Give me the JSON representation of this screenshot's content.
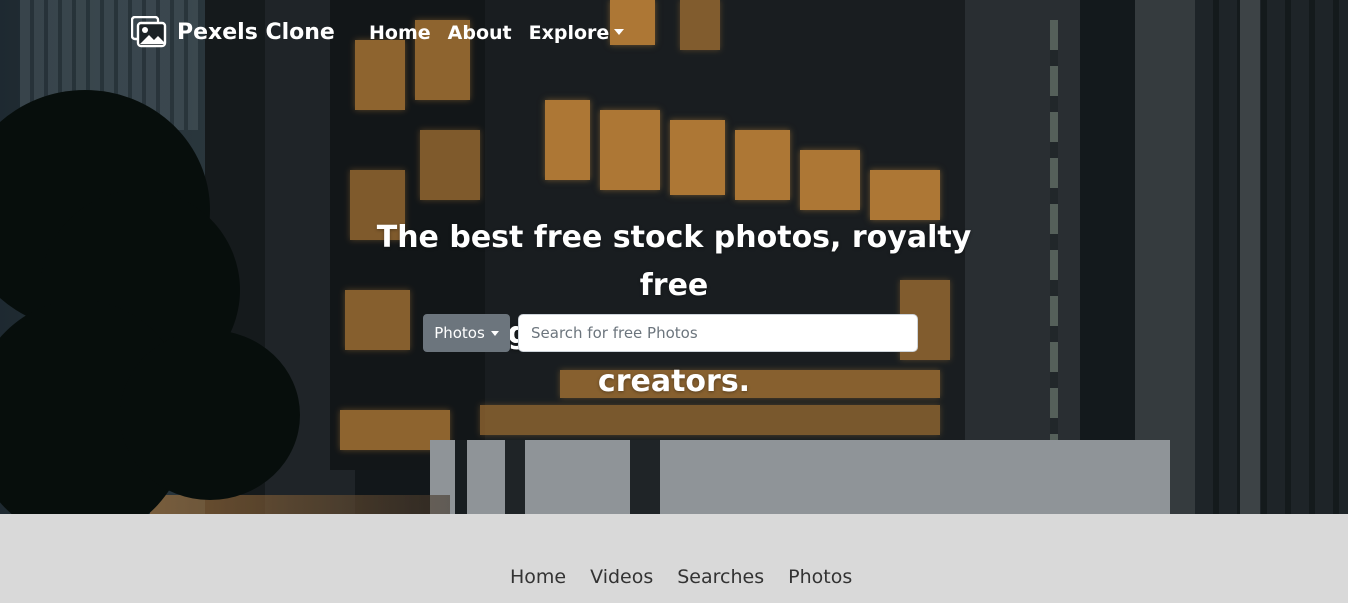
{
  "brand": {
    "name": "Pexels Clone",
    "icon": "images-icon"
  },
  "nav": {
    "links": [
      {
        "label": "Home"
      },
      {
        "label": "About"
      },
      {
        "label": "Explore"
      }
    ]
  },
  "hero": {
    "headline_line1": "The best free stock photos, royalty free",
    "headline_line2": "images & videos shared by creators."
  },
  "search": {
    "type_button": "Photos",
    "placeholder": "Search for free Photos",
    "value": ""
  },
  "footer": {
    "links": [
      {
        "label": "Home"
      },
      {
        "label": "Videos"
      },
      {
        "label": "Searches"
      },
      {
        "label": "Photos"
      }
    ]
  },
  "colors": {
    "button_secondary": "#6c757d",
    "footer_bg": "#d9d9d9",
    "nav_text": "#ffffff"
  }
}
